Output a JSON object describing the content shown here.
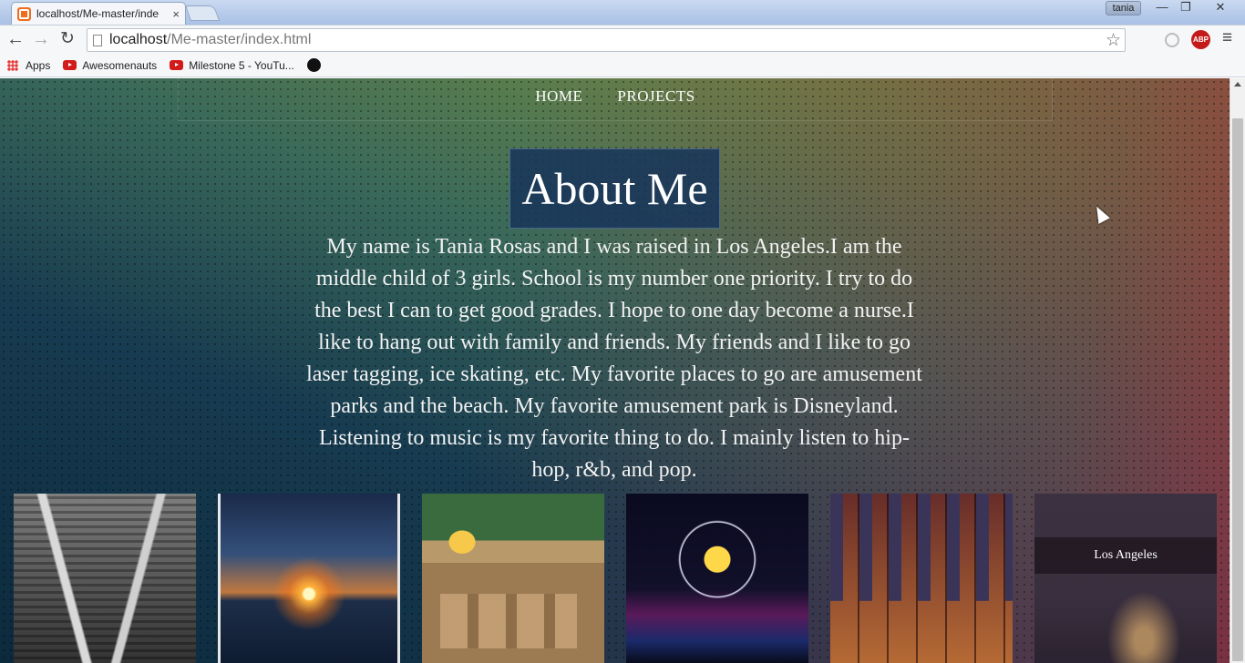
{
  "browser": {
    "tab_title": "localhost/Me-master/inde",
    "tab_close": "×",
    "user_name": "tania",
    "window_buttons": {
      "minimize": "—",
      "maximize": "❐",
      "close": "✕"
    },
    "nav": {
      "back": "←",
      "forward": "→",
      "reload": "↻"
    },
    "url_host": "localhost",
    "url_path": "/Me-master/index.html",
    "star": "☆",
    "abp_label": "ABP",
    "menu": "≡",
    "bookmarks": [
      {
        "label": "Apps",
        "icon": "apps-grid-icon"
      },
      {
        "label": "Awesomenauts",
        "icon": "youtube-icon"
      },
      {
        "label": "Milestone 5 - YouTu...",
        "icon": "youtube-icon"
      },
      {
        "label": "",
        "icon": "github-icon"
      }
    ]
  },
  "page": {
    "nav_links": [
      "HOME",
      "PROJECTS"
    ],
    "heading": "About Me",
    "bio": "My name is Tania Rosas and I was raised in Los Angeles.I am the middle child of 3 girls. School is my number one priority. I try to do the best I can to get good grades. I hope to one day become a nurse.I like to hang out with family and friends. My friends and I like to go laser tagging, ice skating, etc. My favorite places to go are amusement parks and the beach. My favorite amusement park is Disneyland. Listening to music is my favorite thing to do. I mainly listen to hip-hop, r&b, and pop.",
    "gallery": [
      {
        "subject": "roller-coaster",
        "caption": ""
      },
      {
        "subject": "sunset-beach",
        "caption": ""
      },
      {
        "subject": "cartoon-classroom",
        "caption": ""
      },
      {
        "subject": "disney-ferris-wheel",
        "caption": ""
      },
      {
        "subject": "piano-city",
        "caption": ""
      },
      {
        "subject": "los-angeles-night",
        "caption": "Los Angeles"
      }
    ]
  }
}
